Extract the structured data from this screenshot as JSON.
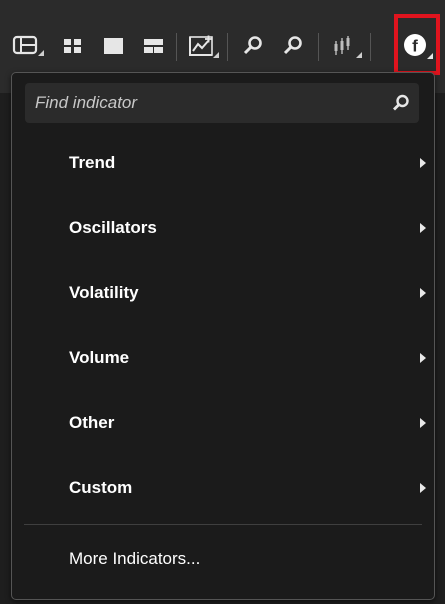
{
  "toolbar": {
    "icons": [
      "layout-panel-icon",
      "grid-four-icon",
      "single-chart-icon",
      "split-horizontal-icon",
      "chart-add-icon",
      "zoom-in-icon",
      "zoom-out-icon",
      "candlestick-icon",
      "indicators-f-icon"
    ],
    "active_icon_letter": "f",
    "highlight_color": "#e0141e"
  },
  "menu": {
    "search": {
      "placeholder": "Find indicator",
      "value": ""
    },
    "items": [
      {
        "label": "Trend"
      },
      {
        "label": "Oscillators"
      },
      {
        "label": "Volatility"
      },
      {
        "label": "Volume"
      },
      {
        "label": "Other"
      },
      {
        "label": "Custom"
      }
    ],
    "more_label": "More Indicators..."
  }
}
